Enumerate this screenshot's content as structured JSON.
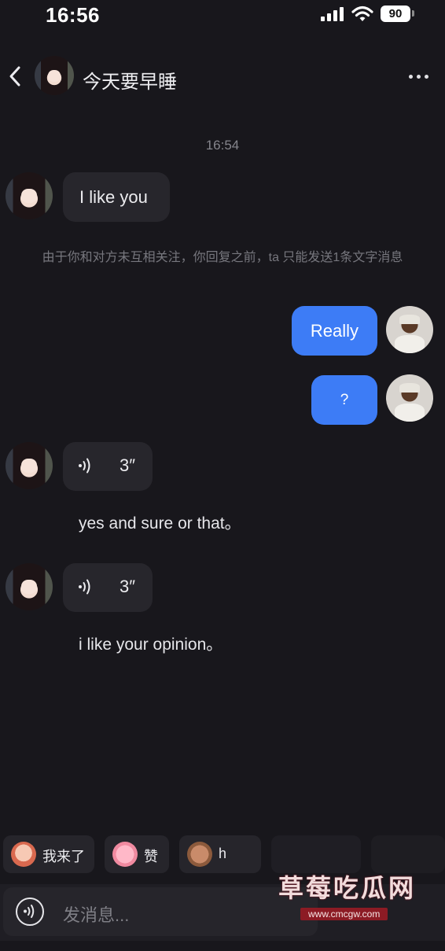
{
  "status_bar": {
    "time": "16:56",
    "battery": "90",
    "icons": [
      "signal-icon",
      "wifi-icon",
      "battery-icon"
    ]
  },
  "header": {
    "title": "今天要早睡",
    "back_icon": "chevron-left-icon",
    "more_icon": "more-horizontal-icon"
  },
  "chat": {
    "timestamp": "16:54",
    "msg1": "I like you",
    "system_notice": "由于你和对方未互相关注，你回复之前，ta 只能发送1条文字消息",
    "out1": "Really",
    "out2": "?",
    "voice1": {
      "duration": "3″",
      "transcript": "yes and sure or that。"
    },
    "voice2": {
      "duration": "3″",
      "transcript": "i like your opinion。"
    }
  },
  "quick_replies": [
    "我来了",
    "赞",
    "h"
  ],
  "input": {
    "placeholder": "发消息..."
  },
  "watermark": {
    "text": "草莓吃瓜网",
    "url": "www.cmcgw.com"
  },
  "colors": {
    "background": "#18171c",
    "incoming_bubble": "#27262c",
    "outgoing_bubble": "#3d7cf6",
    "secondary_text": "#85858c"
  }
}
